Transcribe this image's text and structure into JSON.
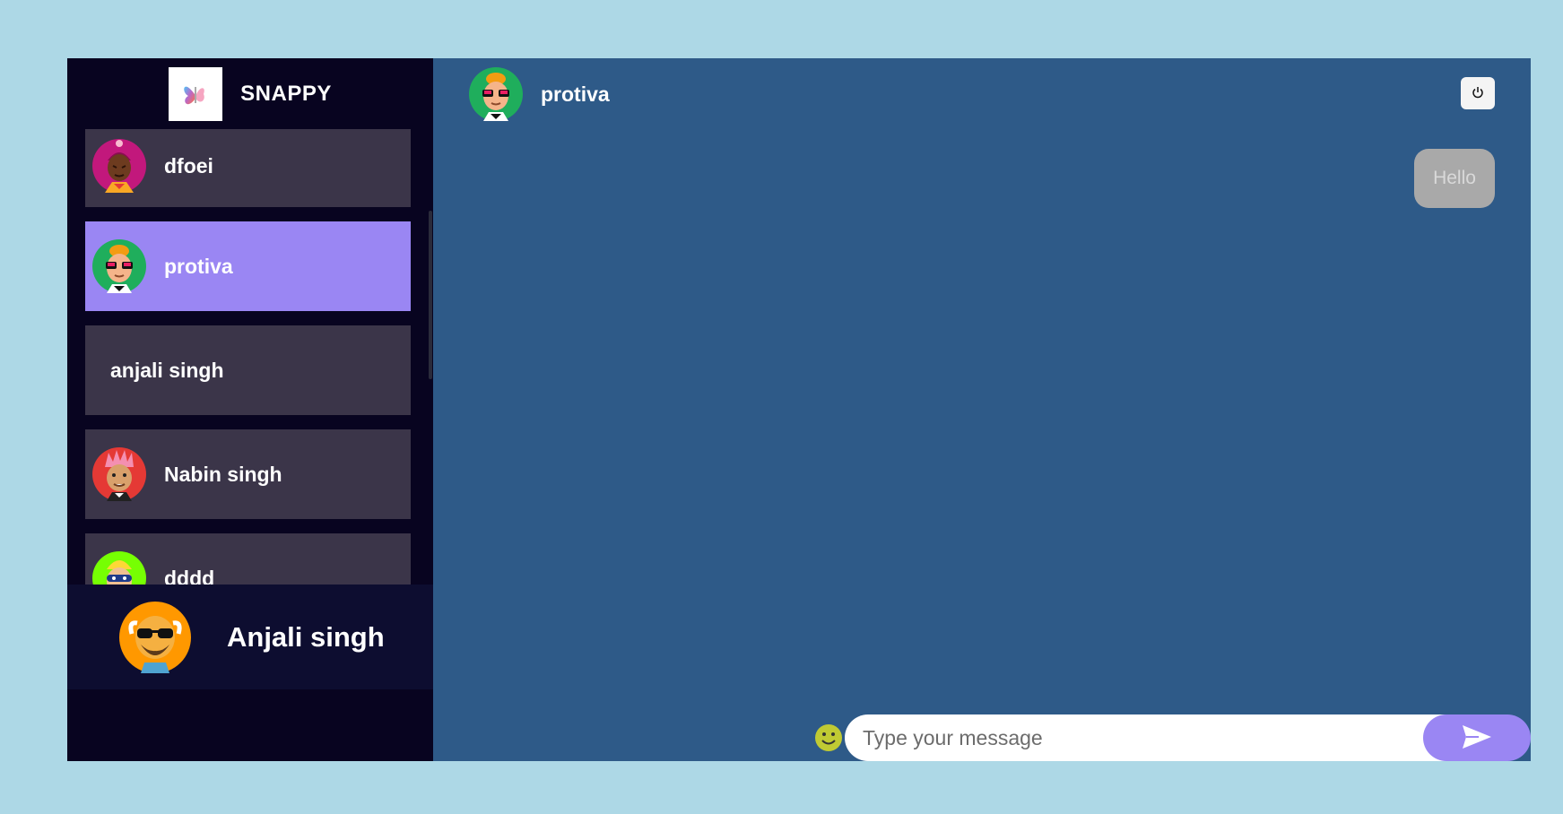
{
  "app": {
    "brand_name": "SNAPPY"
  },
  "contacts": [
    {
      "name": "dfoei",
      "avatar": "avatar-magenta-beanie-icon",
      "selected": false
    },
    {
      "name": "protiva",
      "avatar": "avatar-green-sunglasses-icon",
      "selected": true
    },
    {
      "name": "anjali singh",
      "avatar": null,
      "selected": false
    },
    {
      "name": "Nabin singh",
      "avatar": "avatar-red-spiky-hair-icon",
      "selected": false
    },
    {
      "name": "dddd",
      "avatar": "avatar-green-mask-icon",
      "selected": false
    }
  ],
  "current_user": {
    "name": "Anjali singh",
    "avatar": "avatar-orange-sunglasses-beard-icon"
  },
  "chat": {
    "header_name": "protiva",
    "header_avatar": "avatar-green-sunglasses-icon",
    "logout_icon": "power-icon",
    "messages": [
      {
        "text": "Hello",
        "sent": true
      }
    ],
    "input_placeholder": "Type your message",
    "emoji_icon": "smiley-icon",
    "send_icon": "send-arrow-icon"
  },
  "colors": {
    "page_bg": "#add8e6",
    "sidebar_bg": "#080420",
    "contact_bg": "#3b3549",
    "selected_bg": "#9a86f3",
    "chat_bg": "#2e5a88",
    "current_user_bg": "#0d0d30"
  }
}
